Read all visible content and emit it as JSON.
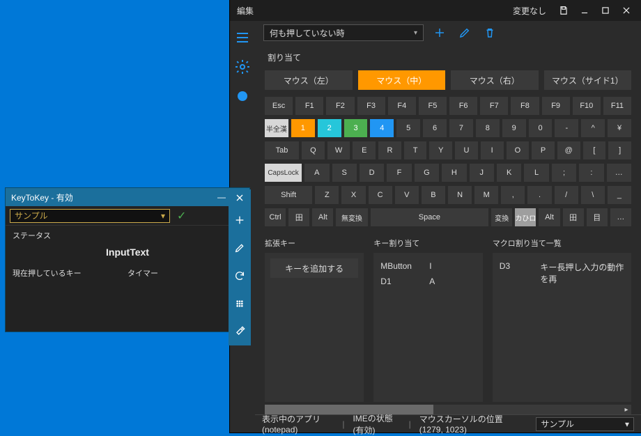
{
  "main_window": {
    "title": "編集",
    "status_text": "変更なし",
    "condition": {
      "selected": "何も押していない時"
    },
    "section_label": "割り当て",
    "mouse_buttons": [
      {
        "label": "マウス（左）",
        "active": false
      },
      {
        "label": "マウス（中）",
        "active": true
      },
      {
        "label": "マウス（右）",
        "active": false
      },
      {
        "label": "マウス（サイド1）",
        "active": false
      }
    ],
    "keyboard_rows": [
      [
        {
          "label": "Esc",
          "cls": ""
        },
        {
          "label": "F1"
        },
        {
          "label": "F2"
        },
        {
          "label": "F3"
        },
        {
          "label": "F4"
        },
        {
          "label": "F5"
        },
        {
          "label": "F6"
        },
        {
          "label": "F7"
        },
        {
          "label": "F8"
        },
        {
          "label": "F9"
        },
        {
          "label": "F10"
        },
        {
          "label": "F11"
        }
      ],
      [
        {
          "label": "半全漢",
          "cls": "light lbl-sm"
        },
        {
          "label": "1",
          "cls": "orange"
        },
        {
          "label": "2",
          "cls": "teal"
        },
        {
          "label": "3",
          "cls": "green"
        },
        {
          "label": "4",
          "cls": "blue"
        },
        {
          "label": "5"
        },
        {
          "label": "6"
        },
        {
          "label": "7"
        },
        {
          "label": "8"
        },
        {
          "label": "9"
        },
        {
          "label": "0"
        },
        {
          "label": "-"
        },
        {
          "label": "^"
        },
        {
          "label": "¥"
        }
      ],
      [
        {
          "label": "Tab",
          "cls": "wide15"
        },
        {
          "label": "Q"
        },
        {
          "label": "W"
        },
        {
          "label": "E"
        },
        {
          "label": "R"
        },
        {
          "label": "T"
        },
        {
          "label": "Y"
        },
        {
          "label": "U"
        },
        {
          "label": "I"
        },
        {
          "label": "O"
        },
        {
          "label": "P"
        },
        {
          "label": "@"
        },
        {
          "label": "["
        },
        {
          "label": "]"
        }
      ],
      [
        {
          "label": "CapsLock",
          "cls": "light wide15 lbl-sm"
        },
        {
          "label": "A"
        },
        {
          "label": "S"
        },
        {
          "label": "D"
        },
        {
          "label": "F"
        },
        {
          "label": "G"
        },
        {
          "label": "H"
        },
        {
          "label": "J"
        },
        {
          "label": "K"
        },
        {
          "label": "L"
        },
        {
          "label": ";"
        },
        {
          "label": ":"
        },
        {
          "label": "…"
        }
      ],
      [
        {
          "label": "Shift",
          "cls": "wide2"
        },
        {
          "label": "Z"
        },
        {
          "label": "X"
        },
        {
          "label": "C"
        },
        {
          "label": "V"
        },
        {
          "label": "B"
        },
        {
          "label": "N"
        },
        {
          "label": "M"
        },
        {
          "label": ","
        },
        {
          "label": "."
        },
        {
          "label": "/"
        },
        {
          "label": "\\"
        },
        {
          "label": "_"
        }
      ],
      [
        {
          "label": "Ctrl",
          "cls": ""
        },
        {
          "label": "田"
        },
        {
          "label": "Alt"
        },
        {
          "label": "無変換",
          "cls": "wide15 lbl-sm"
        },
        {
          "label": "Space",
          "cls": "wide6"
        },
        {
          "label": "変換",
          "cls": "lbl-sm"
        },
        {
          "label": "カひロ",
          "cls": "grayl lbl-sm"
        },
        {
          "label": "Alt"
        },
        {
          "label": "田"
        },
        {
          "label": "目"
        },
        {
          "label": "…"
        }
      ]
    ],
    "panels": {
      "ext_keys": {
        "title": "拡張キー",
        "add_button": "キーを追加する"
      },
      "key_map": {
        "title": "キー割り当て",
        "rows": [
          {
            "from": "MButton",
            "to": "I"
          },
          {
            "from": "D1",
            "to": "A"
          }
        ]
      },
      "macro_map": {
        "title": "マクロ割り当て一覧",
        "rows": [
          {
            "from": "D3",
            "to": "キー長押し入力の動作を再"
          }
        ]
      }
    },
    "statusbar": {
      "app": "表示中のアプリ(notepad)",
      "ime": "IMEの状態(有効)",
      "cursor": "マウスカーソルの位置(1279, 1023)",
      "profile": "サンプル"
    }
  },
  "small_window": {
    "title": "KeyToKey - 有効",
    "profile": "サンプル",
    "status_label": "ステータス",
    "center_text": "InputText",
    "col_left": "現在押しているキー",
    "col_right": "タイマー"
  }
}
